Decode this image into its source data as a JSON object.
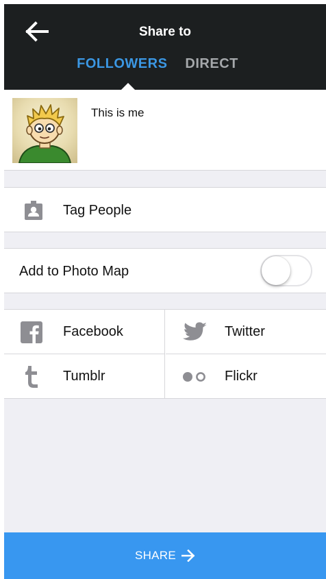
{
  "header": {
    "title": "Share to",
    "back_icon": "arrow-left-icon",
    "tabs": [
      {
        "label": "FOLLOWERS",
        "active": true
      },
      {
        "label": "DIRECT",
        "active": false
      }
    ],
    "colors": {
      "background": "#1c1f20",
      "active_tab": "#3b97e3",
      "inactive_tab": "#a5a8ab"
    }
  },
  "caption": {
    "text": "This is me",
    "avatar": "cartoon-boy-avatar"
  },
  "tag_people": {
    "label": "Tag People",
    "icon": "person-tag-icon"
  },
  "photo_map": {
    "label": "Add to Photo Map",
    "enabled": false
  },
  "social": {
    "items": [
      {
        "label": "Facebook",
        "icon": "facebook-icon"
      },
      {
        "label": "Twitter",
        "icon": "twitter-icon"
      },
      {
        "label": "Tumblr",
        "icon": "tumblr-icon"
      },
      {
        "label": "Flickr",
        "icon": "flickr-icon"
      }
    ]
  },
  "share": {
    "label": "SHARE",
    "icon": "arrow-right-icon",
    "color": "#3897f0"
  }
}
